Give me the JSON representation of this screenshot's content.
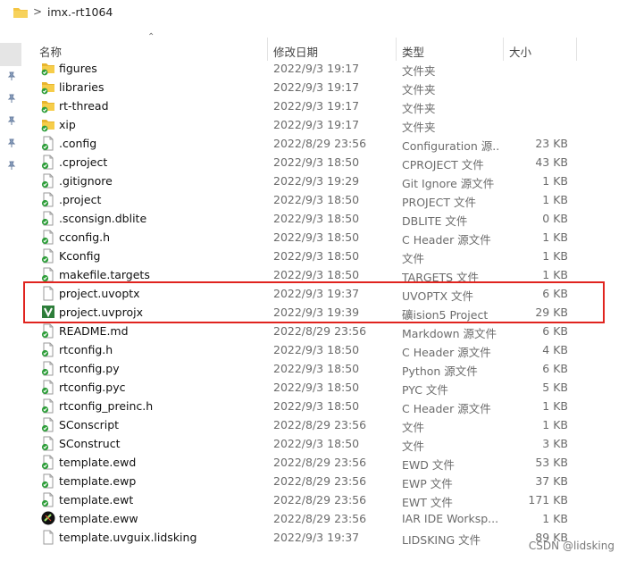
{
  "address_bar": {
    "path": "imx.-rt1064",
    "separator": ">"
  },
  "columns": {
    "name": "名称",
    "modified": "修改日期",
    "type": "类型",
    "size": "大小"
  },
  "files": [
    {
      "name": "figures",
      "date": "2022/9/3 19:17",
      "type": "文件夹",
      "size": "",
      "icon": "folder-icon"
    },
    {
      "name": "libraries",
      "date": "2022/9/3 19:17",
      "type": "文件夹",
      "size": "",
      "icon": "folder-icon"
    },
    {
      "name": "rt-thread",
      "date": "2022/9/3 19:17",
      "type": "文件夹",
      "size": "",
      "icon": "folder-icon"
    },
    {
      "name": "xip",
      "date": "2022/9/3 19:17",
      "type": "文件夹",
      "size": "",
      "icon": "folder-icon"
    },
    {
      "name": ".config",
      "date": "2022/8/29 23:56",
      "type": "Configuration 源...",
      "size": "23 KB",
      "icon": "synced-file-icon"
    },
    {
      "name": ".cproject",
      "date": "2022/9/3 18:50",
      "type": "CPROJECT 文件",
      "size": "43 KB",
      "icon": "synced-file-icon"
    },
    {
      "name": ".gitignore",
      "date": "2022/9/3 19:29",
      "type": "Git Ignore 源文件",
      "size": "1 KB",
      "icon": "synced-file-icon"
    },
    {
      "name": ".project",
      "date": "2022/9/3 18:50",
      "type": "PROJECT 文件",
      "size": "1 KB",
      "icon": "synced-file-icon"
    },
    {
      "name": ".sconsign.dblite",
      "date": "2022/9/3 18:50",
      "type": "DBLITE 文件",
      "size": "0 KB",
      "icon": "synced-file-icon"
    },
    {
      "name": "cconfig.h",
      "date": "2022/9/3 18:50",
      "type": "C Header 源文件",
      "size": "1 KB",
      "icon": "synced-file-icon"
    },
    {
      "name": "Kconfig",
      "date": "2022/9/3 18:50",
      "type": "文件",
      "size": "1 KB",
      "icon": "synced-file-icon"
    },
    {
      "name": "makefile.targets",
      "date": "2022/9/3 18:50",
      "type": "TARGETS 文件",
      "size": "1 KB",
      "icon": "synced-file-icon"
    },
    {
      "name": "project.uvoptx",
      "date": "2022/9/3 19:37",
      "type": "UVOPTX 文件",
      "size": "6 KB",
      "icon": "blank-file-icon"
    },
    {
      "name": "project.uvprojx",
      "date": "2022/9/3 19:39",
      "type": "礦ision5 Project",
      "size": "29 KB",
      "icon": "keil-project-icon"
    },
    {
      "name": "README.md",
      "date": "2022/8/29 23:56",
      "type": "Markdown 源文件",
      "size": "6 KB",
      "icon": "synced-file-icon"
    },
    {
      "name": "rtconfig.h",
      "date": "2022/9/3 18:50",
      "type": "C Header 源文件",
      "size": "4 KB",
      "icon": "synced-file-icon"
    },
    {
      "name": "rtconfig.py",
      "date": "2022/9/3 18:50",
      "type": "Python 源文件",
      "size": "6 KB",
      "icon": "synced-file-icon"
    },
    {
      "name": "rtconfig.pyc",
      "date": "2022/9/3 18:50",
      "type": "PYC 文件",
      "size": "5 KB",
      "icon": "synced-file-icon"
    },
    {
      "name": "rtconfig_preinc.h",
      "date": "2022/9/3 18:50",
      "type": "C Header 源文件",
      "size": "1 KB",
      "icon": "synced-file-icon"
    },
    {
      "name": "SConscript",
      "date": "2022/8/29 23:56",
      "type": "文件",
      "size": "1 KB",
      "icon": "synced-file-icon"
    },
    {
      "name": "SConstruct",
      "date": "2022/9/3 18:50",
      "type": "文件",
      "size": "3 KB",
      "icon": "synced-file-icon"
    },
    {
      "name": "template.ewd",
      "date": "2022/8/29 23:56",
      "type": "EWD 文件",
      "size": "53 KB",
      "icon": "synced-file-icon"
    },
    {
      "name": "template.ewp",
      "date": "2022/8/29 23:56",
      "type": "EWP 文件",
      "size": "37 KB",
      "icon": "synced-file-icon"
    },
    {
      "name": "template.ewt",
      "date": "2022/8/29 23:56",
      "type": "EWT 文件",
      "size": "171 KB",
      "icon": "synced-file-icon"
    },
    {
      "name": "template.eww",
      "date": "2022/8/29 23:56",
      "type": "IAR IDE Worksp...",
      "size": "1 KB",
      "icon": "iar-workspace-icon"
    },
    {
      "name": "template.uvguix.lidsking",
      "date": "2022/9/3 19:37",
      "type": "LIDSKING 文件",
      "size": "89 KB",
      "icon": "blank-file-icon"
    }
  ],
  "watermark": "CSDN @lidsking",
  "colors": {
    "highlight_border": "#e0241f",
    "folder": "#f4c542",
    "sync_green": "#2e9e3a"
  }
}
